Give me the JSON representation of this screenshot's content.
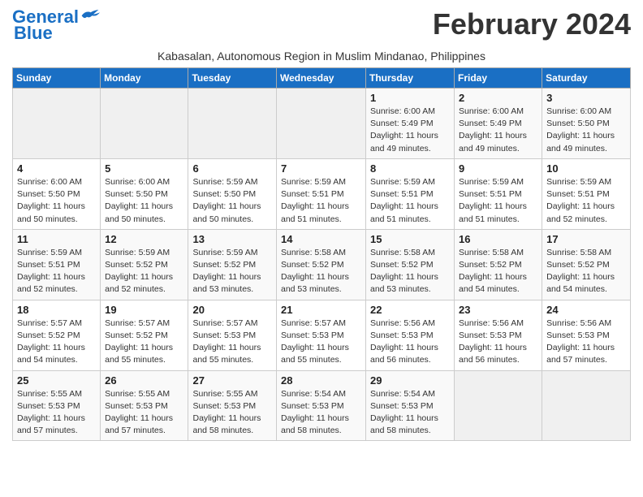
{
  "logo": {
    "line1": "General",
    "line2": "Blue"
  },
  "title": "February 2024",
  "location": "Kabasalan, Autonomous Region in Muslim Mindanao, Philippines",
  "days_of_week": [
    "Sunday",
    "Monday",
    "Tuesday",
    "Wednesday",
    "Thursday",
    "Friday",
    "Saturday"
  ],
  "weeks": [
    [
      {
        "day": "",
        "info": ""
      },
      {
        "day": "",
        "info": ""
      },
      {
        "day": "",
        "info": ""
      },
      {
        "day": "",
        "info": ""
      },
      {
        "day": "1",
        "info": "Sunrise: 6:00 AM\nSunset: 5:49 PM\nDaylight: 11 hours\nand 49 minutes."
      },
      {
        "day": "2",
        "info": "Sunrise: 6:00 AM\nSunset: 5:49 PM\nDaylight: 11 hours\nand 49 minutes."
      },
      {
        "day": "3",
        "info": "Sunrise: 6:00 AM\nSunset: 5:50 PM\nDaylight: 11 hours\nand 49 minutes."
      }
    ],
    [
      {
        "day": "4",
        "info": "Sunrise: 6:00 AM\nSunset: 5:50 PM\nDaylight: 11 hours\nand 50 minutes."
      },
      {
        "day": "5",
        "info": "Sunrise: 6:00 AM\nSunset: 5:50 PM\nDaylight: 11 hours\nand 50 minutes."
      },
      {
        "day": "6",
        "info": "Sunrise: 5:59 AM\nSunset: 5:50 PM\nDaylight: 11 hours\nand 50 minutes."
      },
      {
        "day": "7",
        "info": "Sunrise: 5:59 AM\nSunset: 5:51 PM\nDaylight: 11 hours\nand 51 minutes."
      },
      {
        "day": "8",
        "info": "Sunrise: 5:59 AM\nSunset: 5:51 PM\nDaylight: 11 hours\nand 51 minutes."
      },
      {
        "day": "9",
        "info": "Sunrise: 5:59 AM\nSunset: 5:51 PM\nDaylight: 11 hours\nand 51 minutes."
      },
      {
        "day": "10",
        "info": "Sunrise: 5:59 AM\nSunset: 5:51 PM\nDaylight: 11 hours\nand 52 minutes."
      }
    ],
    [
      {
        "day": "11",
        "info": "Sunrise: 5:59 AM\nSunset: 5:51 PM\nDaylight: 11 hours\nand 52 minutes."
      },
      {
        "day": "12",
        "info": "Sunrise: 5:59 AM\nSunset: 5:52 PM\nDaylight: 11 hours\nand 52 minutes."
      },
      {
        "day": "13",
        "info": "Sunrise: 5:59 AM\nSunset: 5:52 PM\nDaylight: 11 hours\nand 53 minutes."
      },
      {
        "day": "14",
        "info": "Sunrise: 5:58 AM\nSunset: 5:52 PM\nDaylight: 11 hours\nand 53 minutes."
      },
      {
        "day": "15",
        "info": "Sunrise: 5:58 AM\nSunset: 5:52 PM\nDaylight: 11 hours\nand 53 minutes."
      },
      {
        "day": "16",
        "info": "Sunrise: 5:58 AM\nSunset: 5:52 PM\nDaylight: 11 hours\nand 54 minutes."
      },
      {
        "day": "17",
        "info": "Sunrise: 5:58 AM\nSunset: 5:52 PM\nDaylight: 11 hours\nand 54 minutes."
      }
    ],
    [
      {
        "day": "18",
        "info": "Sunrise: 5:57 AM\nSunset: 5:52 PM\nDaylight: 11 hours\nand 54 minutes."
      },
      {
        "day": "19",
        "info": "Sunrise: 5:57 AM\nSunset: 5:52 PM\nDaylight: 11 hours\nand 55 minutes."
      },
      {
        "day": "20",
        "info": "Sunrise: 5:57 AM\nSunset: 5:53 PM\nDaylight: 11 hours\nand 55 minutes."
      },
      {
        "day": "21",
        "info": "Sunrise: 5:57 AM\nSunset: 5:53 PM\nDaylight: 11 hours\nand 55 minutes."
      },
      {
        "day": "22",
        "info": "Sunrise: 5:56 AM\nSunset: 5:53 PM\nDaylight: 11 hours\nand 56 minutes."
      },
      {
        "day": "23",
        "info": "Sunrise: 5:56 AM\nSunset: 5:53 PM\nDaylight: 11 hours\nand 56 minutes."
      },
      {
        "day": "24",
        "info": "Sunrise: 5:56 AM\nSunset: 5:53 PM\nDaylight: 11 hours\nand 57 minutes."
      }
    ],
    [
      {
        "day": "25",
        "info": "Sunrise: 5:55 AM\nSunset: 5:53 PM\nDaylight: 11 hours\nand 57 minutes."
      },
      {
        "day": "26",
        "info": "Sunrise: 5:55 AM\nSunset: 5:53 PM\nDaylight: 11 hours\nand 57 minutes."
      },
      {
        "day": "27",
        "info": "Sunrise: 5:55 AM\nSunset: 5:53 PM\nDaylight: 11 hours\nand 58 minutes."
      },
      {
        "day": "28",
        "info": "Sunrise: 5:54 AM\nSunset: 5:53 PM\nDaylight: 11 hours\nand 58 minutes."
      },
      {
        "day": "29",
        "info": "Sunrise: 5:54 AM\nSunset: 5:53 PM\nDaylight: 11 hours\nand 58 minutes."
      },
      {
        "day": "",
        "info": ""
      },
      {
        "day": "",
        "info": ""
      }
    ]
  ]
}
